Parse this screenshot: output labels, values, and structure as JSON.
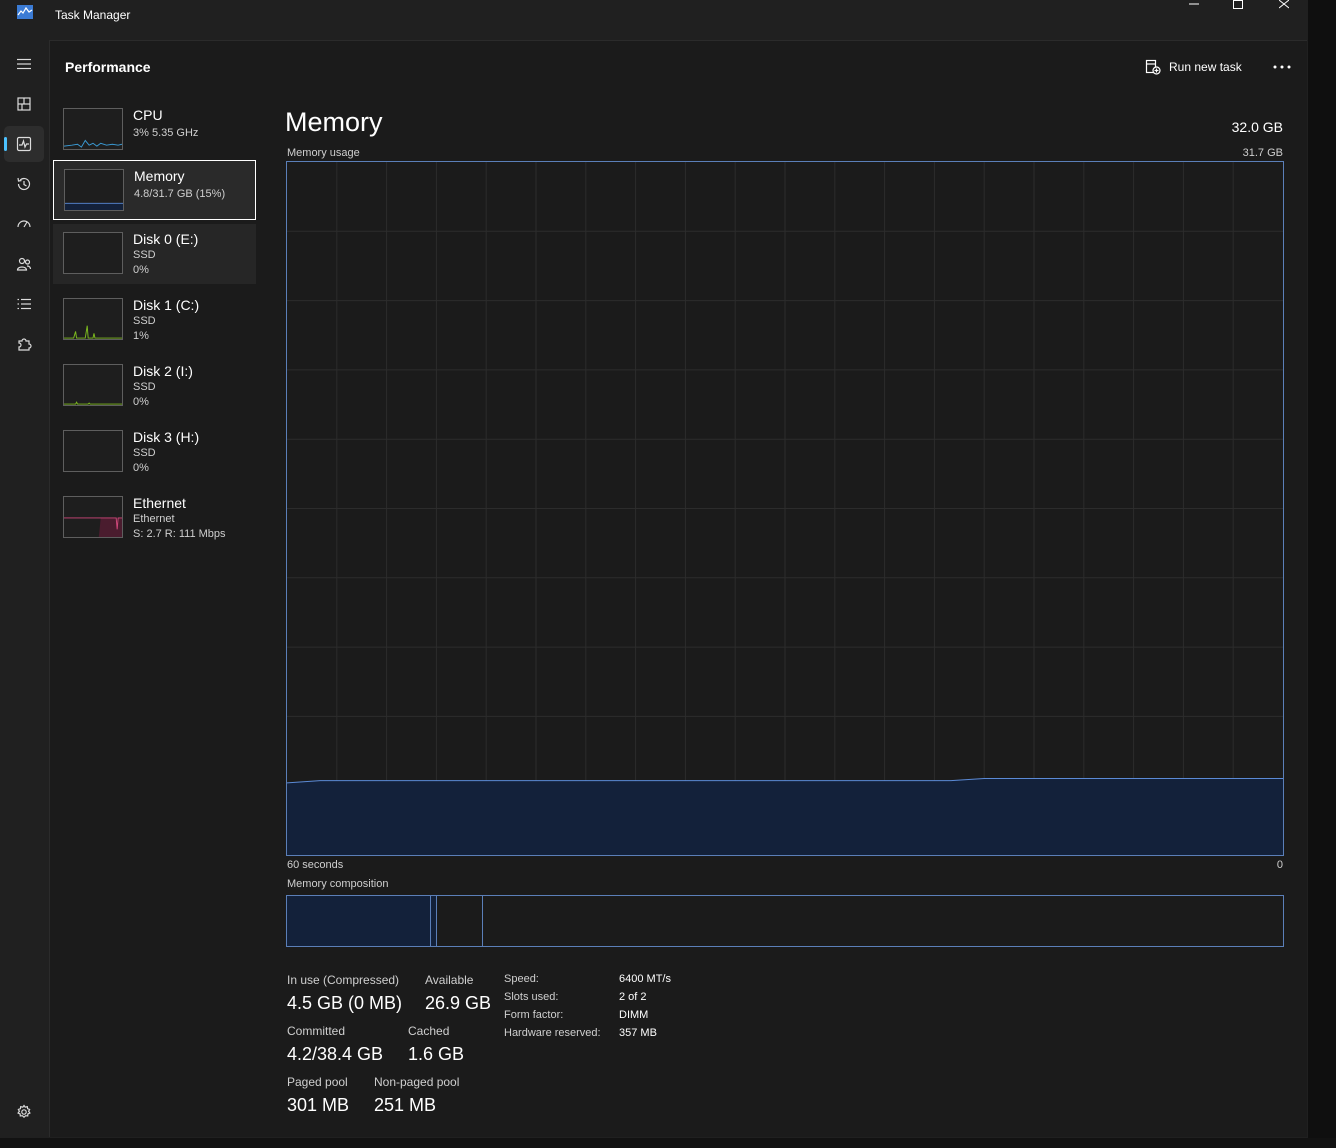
{
  "window": {
    "title": "Task Manager"
  },
  "header": {
    "page_title": "Performance",
    "run_new_task": "Run new task"
  },
  "nav": [
    "menu",
    "processes",
    "performance",
    "app-history",
    "startup-apps",
    "users",
    "details",
    "services",
    "settings"
  ],
  "devices": [
    {
      "name": "CPU",
      "line1": "3%  5.35 GHz",
      "line2": ""
    },
    {
      "name": "Memory",
      "line1": "4.8/31.7 GB (15%)",
      "line2": ""
    },
    {
      "name": "Disk 0 (E:)",
      "line1": "SSD",
      "line2": "0%"
    },
    {
      "name": "Disk 1 (C:)",
      "line1": "SSD",
      "line2": "1%"
    },
    {
      "name": "Disk 2 (I:)",
      "line1": "SSD",
      "line2": "0%"
    },
    {
      "name": "Disk 3 (H:)",
      "line1": "SSD",
      "line2": "0%"
    },
    {
      "name": "Ethernet",
      "line1": "Ethernet",
      "line2": "S: 2.7  R: 111 Mbps"
    }
  ],
  "memory": {
    "title": "Memory",
    "total": "32.0 GB",
    "usage_label": "Memory usage",
    "usage_max": "31.7 GB",
    "time_left": "60 seconds",
    "time_right": "0",
    "composition_label": "Memory composition",
    "usage_series_gb": [
      3.3,
      3.4,
      3.4,
      3.4,
      3.4,
      3.4,
      3.4,
      3.4,
      3.4,
      3.4,
      3.4,
      3.4,
      3.4,
      3.4,
      3.4,
      3.4,
      3.4,
      3.4,
      3.4,
      3.4,
      3.4,
      3.5,
      3.5,
      3.5,
      3.5,
      3.5,
      3.5,
      3.5,
      3.5,
      3.5,
      3.5
    ],
    "stats": {
      "in_use_label": "In use (Compressed)",
      "in_use": "4.5 GB (0 MB)",
      "available_label": "Available",
      "available": "26.9 GB",
      "committed_label": "Committed",
      "committed": "4.2/38.4 GB",
      "cached_label": "Cached",
      "cached": "1.6 GB",
      "paged_label": "Paged pool",
      "paged": "301 MB",
      "nonpaged_label": "Non-paged pool",
      "nonpaged": "251 MB"
    },
    "specs": {
      "speed_label": "Speed:",
      "speed": "6400 MT/s",
      "slots_label": "Slots used:",
      "slots": "2 of 2",
      "form_label": "Form factor:",
      "form": "DIMM",
      "reserved_label": "Hardware reserved:",
      "reserved": "357 MB"
    }
  },
  "colors": {
    "accent": "#4cc2ff",
    "memory_line": "#5b8ad6",
    "memory_fill": "#13213a",
    "disk": "#7dbb1e",
    "ethernet": "#d0477a"
  }
}
